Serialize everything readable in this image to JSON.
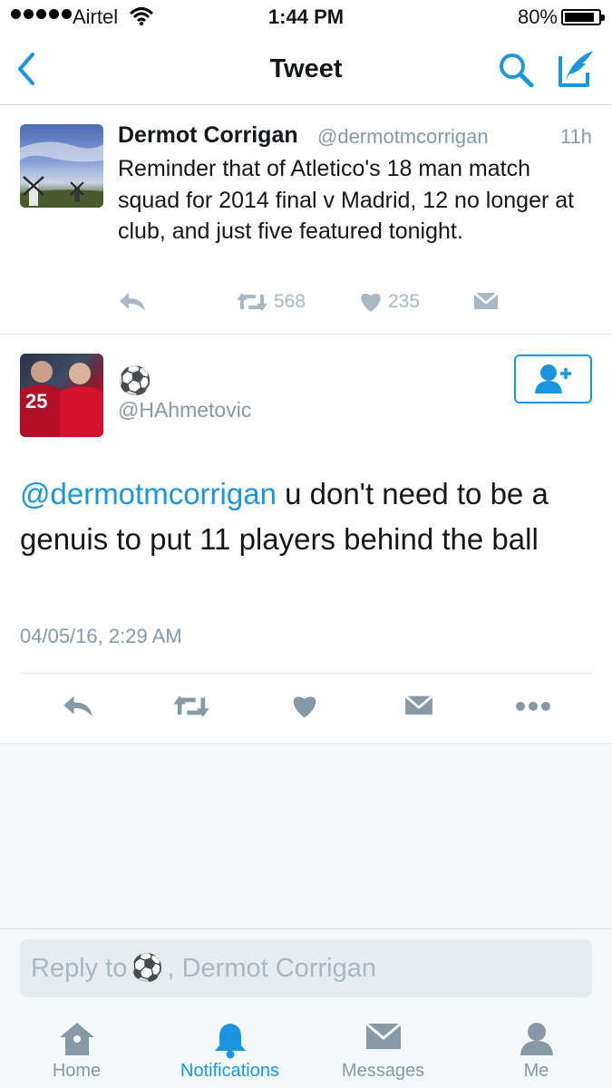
{
  "status_bar": {
    "carrier": "Airtel",
    "time": "1:44 PM",
    "battery": "80%",
    "battery_level": 0.8
  },
  "nav": {
    "title": "Tweet",
    "back_icon": "chevron-left-icon",
    "search_icon": "search-icon",
    "compose_icon": "compose-icon"
  },
  "parent_tweet": {
    "name": "Dermot Corrigan",
    "handle": "@dermotmcorrigan",
    "time": "11h",
    "text": "Reminder that of Atletico's 18 man match squad for 2014 final v Madrid, 12 no longer at club, and just five featured tonight.",
    "retweets": "568",
    "likes": "235"
  },
  "main_tweet": {
    "display_name": "⚽",
    "handle": "@HAhmetovic",
    "mention": "@dermotmcorrigan",
    "text": " u don't need to be a genuis to put 11 players behind the ball",
    "datetime": "04/05/16, 2:29 AM"
  },
  "reply": {
    "placeholder_prefix": "Reply to",
    "emoji": "⚽",
    "placeholder_suffix": ", Dermot Corrigan"
  },
  "tabs": [
    {
      "label": "Home",
      "icon": "home-icon"
    },
    {
      "label": "Notifications",
      "icon": "bell-icon"
    },
    {
      "label": "Messages",
      "icon": "envelope-icon"
    },
    {
      "label": "Me",
      "icon": "person-icon"
    }
  ],
  "colors": {
    "accent": "#1b95e0",
    "muted": "#8899a6",
    "action": "#aab8c2",
    "background": "#f5f8fa"
  }
}
